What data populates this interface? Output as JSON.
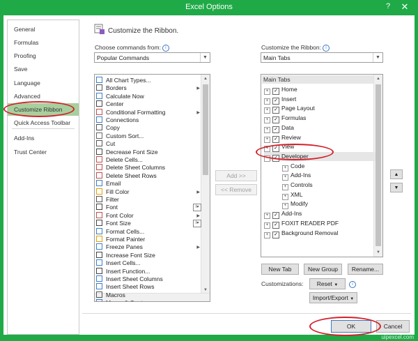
{
  "window": {
    "title": "Excel Options",
    "help_glyph": "?",
    "close_glyph": "✕"
  },
  "nav": {
    "items": [
      {
        "label": "General"
      },
      {
        "label": "Formulas"
      },
      {
        "label": "Proofing"
      },
      {
        "label": "Save"
      },
      {
        "label": "Language"
      },
      {
        "label": "Advanced"
      },
      {
        "label": "Customize Ribbon",
        "active": true
      },
      {
        "label": "Quick Access Toolbar"
      },
      {
        "label": "Add-Ins"
      },
      {
        "label": "Trust Center"
      }
    ]
  },
  "header": {
    "title": "Customize the Ribbon."
  },
  "left": {
    "label": "Choose commands from:",
    "selected": "Popular Commands",
    "commands": [
      {
        "label": "All Chart Types...",
        "icon": "chart-icon"
      },
      {
        "label": "Borders",
        "icon": "borders-icon",
        "submenu": true
      },
      {
        "label": "Calculate Now",
        "icon": "calculator-icon"
      },
      {
        "label": "Center",
        "icon": "center-align-icon"
      },
      {
        "label": "Conditional Formatting",
        "icon": "conditional-format-icon",
        "submenu": true
      },
      {
        "label": "Connections",
        "icon": "connections-icon"
      },
      {
        "label": "Copy",
        "icon": "copy-icon"
      },
      {
        "label": "Custom Sort...",
        "icon": "sort-icon"
      },
      {
        "label": "Cut",
        "icon": "scissors-icon"
      },
      {
        "label": "Decrease Font Size",
        "icon": "decrease-font-icon"
      },
      {
        "label": "Delete Cells...",
        "icon": "delete-cells-icon"
      },
      {
        "label": "Delete Sheet Columns",
        "icon": "delete-columns-icon"
      },
      {
        "label": "Delete Sheet Rows",
        "icon": "delete-rows-icon"
      },
      {
        "label": "Email",
        "icon": "email-icon"
      },
      {
        "label": "Fill Color",
        "icon": "fill-color-icon",
        "submenu": true
      },
      {
        "label": "Filter",
        "icon": "filter-icon"
      },
      {
        "label": "Font",
        "icon": "font-icon",
        "box": true
      },
      {
        "label": "Font Color",
        "icon": "font-color-icon",
        "submenu": true
      },
      {
        "label": "Font Size",
        "icon": "font-size-icon",
        "box": true
      },
      {
        "label": "Format Cells...",
        "icon": "format-cells-icon"
      },
      {
        "label": "Format Painter",
        "icon": "format-painter-icon"
      },
      {
        "label": "Freeze Panes",
        "icon": "freeze-panes-icon",
        "submenu": true
      },
      {
        "label": "Increase Font Size",
        "icon": "increase-font-icon"
      },
      {
        "label": "Insert Cells...",
        "icon": "insert-cells-icon"
      },
      {
        "label": "Insert Function...",
        "icon": "function-icon"
      },
      {
        "label": "Insert Sheet Columns",
        "icon": "insert-columns-icon"
      },
      {
        "label": "Insert Sheet Rows",
        "icon": "insert-rows-icon"
      },
      {
        "label": "Macros",
        "icon": "macros-icon"
      },
      {
        "label": "Merge & Center",
        "icon": "merge-center-icon"
      }
    ]
  },
  "middle": {
    "add": "Add >>",
    "remove": "<< Remove"
  },
  "right": {
    "label": "Customize the Ribbon:",
    "selected": "Main Tabs",
    "tree_header": "Main Tabs",
    "nodes": [
      {
        "label": "Home",
        "level": 0,
        "expander": "+",
        "checked": true
      },
      {
        "label": "Insert",
        "level": 0,
        "expander": "+",
        "checked": true
      },
      {
        "label": "Page Layout",
        "level": 0,
        "expander": "+",
        "checked": true
      },
      {
        "label": "Formulas",
        "level": 0,
        "expander": "+",
        "checked": true
      },
      {
        "label": "Data",
        "level": 0,
        "expander": "+",
        "checked": true
      },
      {
        "label": "Review",
        "level": 0,
        "expander": "+",
        "checked": true
      },
      {
        "label": "View",
        "level": 0,
        "expander": "+",
        "checked": true
      },
      {
        "label": "Developer",
        "level": 0,
        "expander": "−",
        "checked": true,
        "selected": true
      },
      {
        "label": "Code",
        "level": 1,
        "expander": "+"
      },
      {
        "label": "Add-Ins",
        "level": 1,
        "expander": "+"
      },
      {
        "label": "Controls",
        "level": 1,
        "expander": "+"
      },
      {
        "label": "XML",
        "level": 1,
        "expander": "+"
      },
      {
        "label": "Modify",
        "level": 1,
        "expander": "+"
      },
      {
        "label": "Add-Ins",
        "level": 0,
        "expander": "+",
        "checked": true
      },
      {
        "label": "FOXIT READER PDF",
        "level": 0,
        "expander": "+",
        "checked": true
      },
      {
        "label": "Background Removal",
        "level": 0,
        "expander": "+",
        "checked": true
      }
    ],
    "move_up": "▲",
    "move_down": "▼",
    "new_tab": "New Tab",
    "new_group": "New Group",
    "rename": "Rename...",
    "customizations_label": "Customizations:",
    "reset": "Reset",
    "import_export": "Import/Export"
  },
  "footer": {
    "ok": "OK",
    "cancel": "Cancel"
  },
  "watermark": "uipexcel.com",
  "colors": {
    "frame": "#1faa47",
    "active_nav": "#a8cf9e",
    "highlight": "#d4202a"
  }
}
